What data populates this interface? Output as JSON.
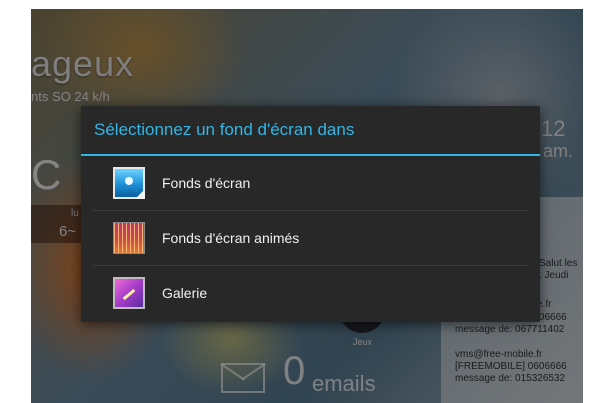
{
  "background": {
    "weather_condition": "ageux",
    "wind": "nts SO 24 k/h",
    "temperature_fragment": "C",
    "forecast_day": "lu",
    "forecast_range": "6~",
    "clock_fragment": "12",
    "clock_suffix": "am.",
    "games_label": "Jeux",
    "email_count": "0",
    "email_label": "emails",
    "sms_lines": [
      "t",
      "Salut les",
      ". Jeudi",
      "e.fr",
      "[FREEMOBILE] 0606666",
      "message de: 067711402",
      "vms@free-mobile.fr",
      "[FREEMOBILE] 0606666",
      "message de: 015326532"
    ]
  },
  "dialog": {
    "title": "Sélectionnez un fond d'écran dans",
    "options": [
      {
        "label": "Fonds d'écran",
        "icon": "wallpaper-icon"
      },
      {
        "label": "Fonds d'écran animés",
        "icon": "live-wallpaper-icon"
      },
      {
        "label": "Galerie",
        "icon": "gallery-icon"
      }
    ],
    "accent_color": "#33b5e5",
    "background_color": "#282828"
  }
}
